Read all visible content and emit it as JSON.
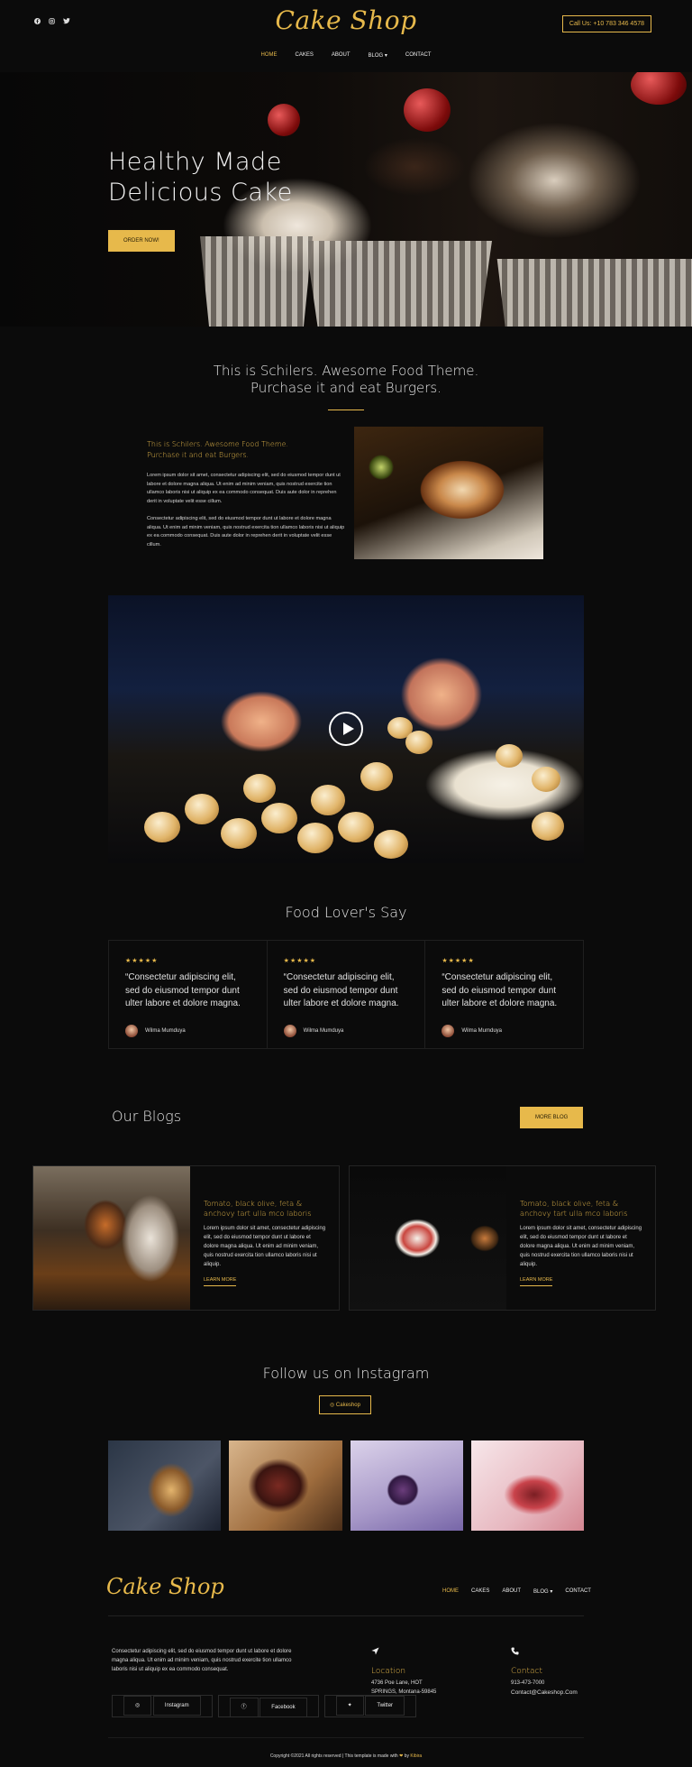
{
  "header": {
    "logo": "Cake Shop",
    "call_button": "Call Us: +10 783 346 4578",
    "social_icons": [
      "facebook-icon",
      "instagram-icon",
      "twitter-icon"
    ],
    "nav": [
      {
        "label": "HOME",
        "active": true
      },
      {
        "label": "CAKES",
        "active": false
      },
      {
        "label": "ABOUT",
        "active": false
      },
      {
        "label": "BLOG",
        "active": false
      },
      {
        "label": "CONTACT",
        "active": false
      }
    ]
  },
  "hero": {
    "title_line1": "Healthy Made",
    "title_line2": "Delicious Cake",
    "button": "ORDER NOW!"
  },
  "intro": {
    "heading_line1": "This is Schilers. Awesome Food Theme.",
    "heading_line2": "Purchase it and eat Burgers.",
    "sub_heading_line1": "This is Schilers. Awesome Food Theme.",
    "sub_heading_line2": "Purchase it and eat Burgers.",
    "paragraph1": "Lorem ipsum dolor sit amet, consectetur adipiscing elit, sed do eiusmod tempor dunt ut labore et dolore magna aliqua. Ut enim ad minim veniam, quis nostrud exercite tion ullamco laboris nisi ut aliquip ex ea commodo consequat. Duis aute dolor in reprehen derit in voluptate velit esse cillum.",
    "paragraph2": "Consectetur adipiscing elit, sed do eiusmod tempor dunt ut labore et dolore magna aliqua. Ut enim ad minim veniam, quis nostrud exercita tion ullamco laboris nisi ut aliquip ex ea commodo consequat. Duis aute dolor in reprehen derit in voluptate velit esse cillum."
  },
  "testimonials": {
    "title": "Food Lover's Say",
    "items": [
      {
        "stars": "★★★★★",
        "quote": "“Consectetur adipiscing elit, sed do eiusmod tempor dunt ulter labore et dolore magna.",
        "author": "Wilma Mumduya"
      },
      {
        "stars": "★★★★★",
        "quote": "“Consectetur adipiscing elit, sed do eiusmod tempor dunt ulter labore et dolore magna.",
        "author": "Wilma Mumduya"
      },
      {
        "stars": "★★★★★",
        "quote": "“Consectetur adipiscing elit, sed do eiusmod tempor dunt ulter labore et dolore magna.",
        "author": "Wilma Mumduya"
      }
    ]
  },
  "blogs": {
    "title": "Our Blogs",
    "more_button": "MORE BLOG",
    "posts": [
      {
        "title": "Tomato, black olive, feta & anchovy tart ulla mco laboris",
        "text": "Lorem ipsum dolor sit amet, consectetur adipiscing elit, sed do eiusmod tempor dunt ut labore et dolore magna aliqua. Ut enim ad minim veniam, quis nostrud exercita tion ullamco laboris nisi ut aliquip.",
        "link": "LEARN MORE"
      },
      {
        "title": "Tomato, black olive, feta & anchovy tart ulla mco laboris",
        "text": "Lorem ipsum dolor sit amet, consectetur adipiscing elit, sed do eiusmod tempor dunt ut labore et dolore magna aliqua. Ut enim ad minim veniam, quis nostrud exercita tion ullamco laboris nisi ut aliquip.",
        "link": "LEARN MORE"
      }
    ]
  },
  "instagram": {
    "title": "Follow us on Instagram",
    "button": "Cakeshop"
  },
  "footer": {
    "logo": "Cake Shop",
    "nav": [
      {
        "label": "HOME",
        "active": true
      },
      {
        "label": "CAKES",
        "active": false
      },
      {
        "label": "ABOUT",
        "active": false
      },
      {
        "label": "BLOG",
        "active": false
      },
      {
        "label": "CONTACT",
        "active": false
      }
    ],
    "about": "Consectetur adipiscing elit, sed do eiusmod tempor dunt ut labore et dolore magna aliqua. Ut enim ad minim veniam, quis nostrud exercite tion ullamco laboris nisi ut aliquip ex ea commodo consequat.",
    "socials": [
      "Instagram",
      "Facebook",
      "Twitter"
    ],
    "location_title": "Location",
    "location_line1": "4736 Poe Lane, HOT",
    "location_line2": "SPRINGS, Montana-59845",
    "contact_title": "Contact",
    "contact_phone": "913-473-7000",
    "contact_email": "Contact@Cakeshop.Com",
    "copyright_prefix": "Copyright ©2021 All rights reserved | This template is made with ",
    "copyright_heart": "❤",
    "copyright_by": " by ",
    "copyright_brand": "Kibira"
  },
  "colors": {
    "accent": "#e7b94b",
    "background": "#0b0b0b"
  }
}
